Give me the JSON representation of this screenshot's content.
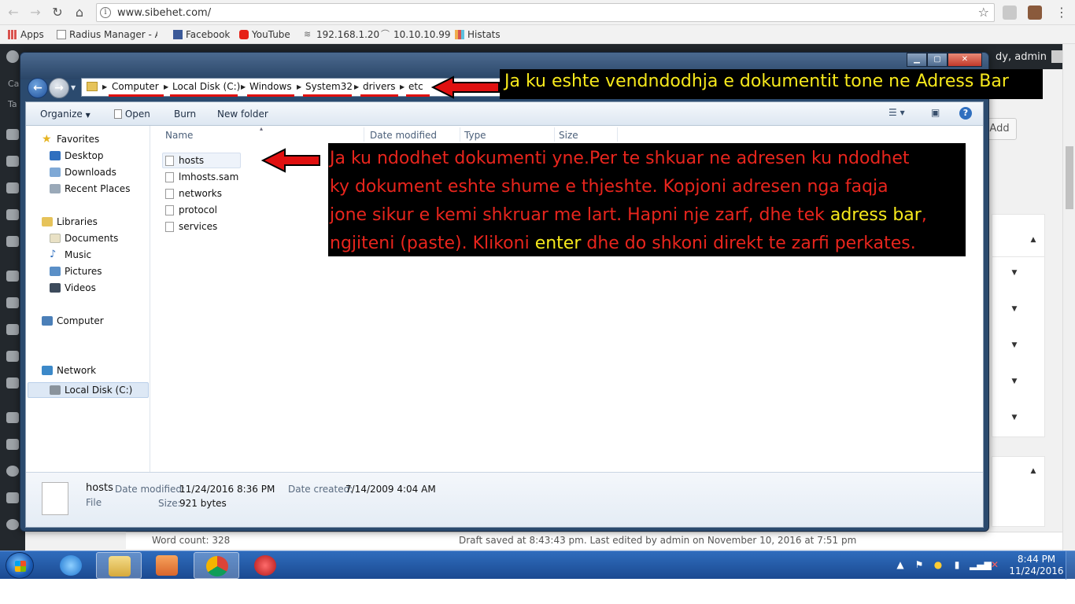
{
  "browser": {
    "url": "www.sibehet.com/",
    "bookmarks": [
      {
        "label": "Apps"
      },
      {
        "label": "Radius Manager - Adı"
      },
      {
        "label": "Facebook"
      },
      {
        "label": "YouTube"
      },
      {
        "label": "192.168.1.20"
      },
      {
        "label": "10.10.10.99"
      },
      {
        "label": "Histats"
      }
    ]
  },
  "wp": {
    "howdy": "dy, admin",
    "add_button": "Add",
    "word_count": "Word count: 328",
    "draft_status": "Draft saved at 8:43:43 pm. Last edited by admin on November 10, 2016 at 7:51 pm",
    "sidebar_text_1": "Ca",
    "sidebar_text_2": "Ta"
  },
  "explorer": {
    "breadcrumbs": [
      "Computer",
      "Local Disk (C:)",
      "Windows",
      "System32",
      "drivers",
      "etc"
    ],
    "commands": {
      "organize": "Organize",
      "open": "Open",
      "burn": "Burn",
      "new_folder": "New folder"
    },
    "nav": {
      "favorites": "Favorites",
      "desktop": "Desktop",
      "downloads": "Downloads",
      "recent_places": "Recent Places",
      "libraries": "Libraries",
      "documents": "Documents",
      "music": "Music",
      "pictures": "Pictures",
      "videos": "Videos",
      "computer": "Computer",
      "local_disk": "Local Disk (C:)",
      "network": "Network"
    },
    "columns": {
      "name": "Name",
      "date_modified": "Date modified",
      "type": "Type",
      "size": "Size"
    },
    "files": [
      "hosts",
      "lmhosts.sam",
      "networks",
      "protocol",
      "services"
    ],
    "details": {
      "name": "hosts",
      "type": "File",
      "date_modified_label": "Date modified:",
      "date_modified": "11/24/2016 8:36 PM",
      "date_created_label": "Date created:",
      "date_created": "7/14/2009 4:04 AM",
      "size_label": "Size:",
      "size": "921 bytes"
    }
  },
  "annotations": {
    "top": "Ja ku eshte vendndodhja e dokumentit tone ne Adress Bar",
    "mid_line1": "Ja ku ndodhet dokumenti yne.Per te shkuar ne adresen ku ndodhet",
    "mid_line2": "ky dokument eshte shume e thjeshte. Kopjoni adresen nga faqja",
    "mid_line3a": "jone sikur e kemi shkruar me lart. Hapni nje zarf, dhe tek",
    "mid_line3_hl": "adress bar",
    "mid_line3b": ",",
    "mid_line4a": "ngjiteni (paste). Klikoni",
    "mid_line4_hl": "enter",
    "mid_line4b": "dhe do shkoni direkt te zarfi perkates."
  },
  "taskbar": {
    "time": "8:44 PM",
    "date": "11/24/2016"
  }
}
